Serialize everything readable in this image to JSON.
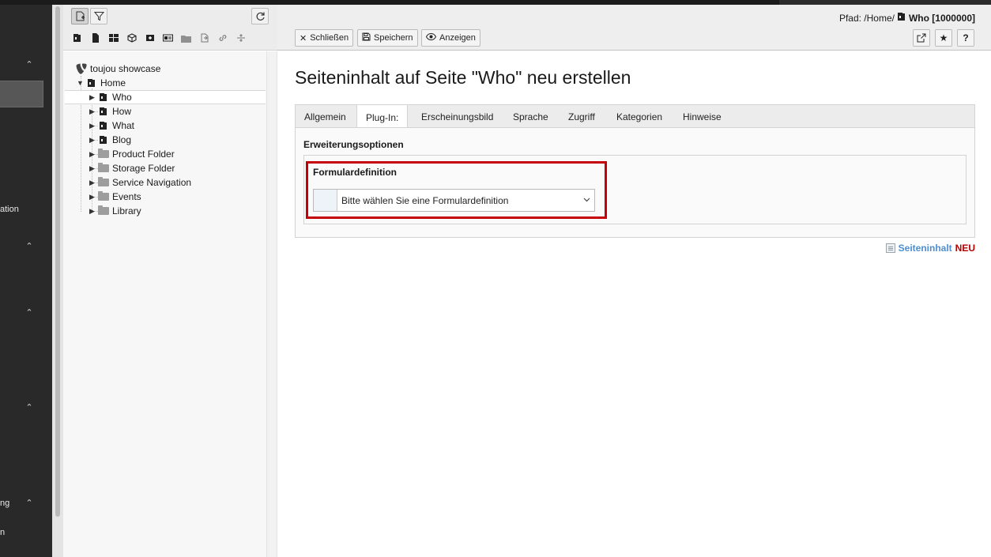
{
  "module_menu": {
    "fragments": [
      "ation",
      "ng",
      "n"
    ]
  },
  "tree_toolbar": {
    "new_page_icon": "page-new-icon",
    "filter_icon": "filter-icon",
    "refresh_icon": "refresh-icon",
    "doktype_icons": [
      "page-icon",
      "document-icon",
      "grid-icon",
      "cube-icon",
      "shortcut-icon",
      "sysfolder-icon",
      "folder-icon",
      "mount-icon",
      "link-icon",
      "divider-icon"
    ]
  },
  "tree": {
    "root": "toujou showcase",
    "home": "Home",
    "children": [
      "Who",
      "How",
      "What",
      "Blog",
      "Product Folder",
      "Storage Folder",
      "Service Navigation",
      "Events",
      "Library"
    ]
  },
  "docheader": {
    "path_prefix": "Pfad: /Home/",
    "path_current": "Who [1000000]",
    "buttons": {
      "close": "Schließen",
      "save": "Speichern",
      "view": "Anzeigen"
    },
    "help": "?"
  },
  "content": {
    "title": "Seiteninhalt auf Seite \"Who\" neu erstellen",
    "tabs": [
      "Allgemein",
      "Plug-In:",
      "Erscheinungsbild",
      "Sprache",
      "Zugriff",
      "Kategorien",
      "Hinweise"
    ],
    "active_tab": "Plug-In:",
    "section_title": "Erweiterungsoptionen",
    "field_label": "Formulardefinition",
    "select_value": "Bitte wählen Sie eine Formulardefinition",
    "content_type": "Seiteninhalt",
    "new_badge": "NEU"
  },
  "colors": {
    "highlight_border": "#c4000b",
    "link_blue": "#4d8ed2",
    "new_red": "#b30000"
  }
}
